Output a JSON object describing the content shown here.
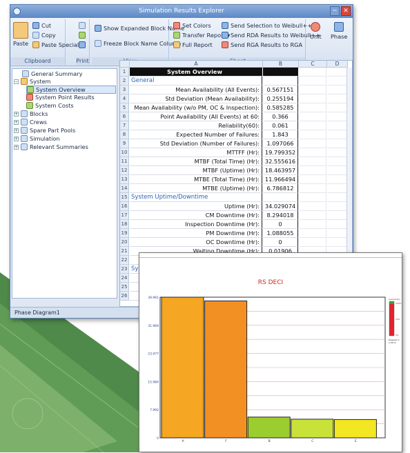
{
  "window": {
    "title": "Simulation Results Explorer"
  },
  "ribbon": {
    "paste": "Paste",
    "cut": "Cut",
    "copy": "Copy",
    "paste_special": "Paste Special",
    "show_expanded": "Show Expanded Block Name",
    "freeze_block": "Freeze Block Name Column",
    "set_colors": "Set Colors",
    "transfer_report": "Transfer Report ▾",
    "full_report": "Full Report",
    "send_selection": "Send Selection to Weibull++",
    "send_rda": "Send RDA Results to Weibull++",
    "send_rga": "Send RGA Results to RGA",
    "unit": "Unit",
    "phase": "Phase",
    "groups": {
      "clipboard": "Clipboard",
      "print": "Print",
      "view": "View",
      "sheet": "Sheet"
    }
  },
  "tree": {
    "general_summary": "General Summary",
    "system": "System",
    "system_overview": "System Overview",
    "system_point_results": "System Point Results",
    "system_costs": "System Costs",
    "blocks": "Blocks",
    "crews": "Crews",
    "spare_part_pools": "Spare Part Pools",
    "simulation": "Simulation",
    "relevant_summaries": "Relevant Summaries"
  },
  "sheet": {
    "columns": [
      "A",
      "B",
      "C",
      "D"
    ],
    "rows": [
      {
        "n": "1",
        "label": "System Overview",
        "value": "",
        "type": "hdr"
      },
      {
        "n": "2",
        "label": "General",
        "value": "",
        "type": "sec"
      },
      {
        "n": "3",
        "label": "Mean Availability (All Events):",
        "value": "0.567151"
      },
      {
        "n": "4",
        "label": "Std Deviation (Mean Availability):",
        "value": "0.255194"
      },
      {
        "n": "5",
        "label": "Mean Availability (w/o PM, OC & Inspection):",
        "value": "0.585285"
      },
      {
        "n": "6",
        "label": "Point Availability (All Events) at 60:",
        "value": "0.366"
      },
      {
        "n": "7",
        "label": "Reliability(60):",
        "value": "0.061"
      },
      {
        "n": "8",
        "label": "Expected Number of Failures:",
        "value": "1.843"
      },
      {
        "n": "9",
        "label": "Std Deviation (Number of Failures):",
        "value": "1.097066"
      },
      {
        "n": "10",
        "label": "MTTFF (Hr):",
        "value": "19.799352"
      },
      {
        "n": "11",
        "label": "MTBF (Total Time) (Hr):",
        "value": "32.555616"
      },
      {
        "n": "12",
        "label": "MTBF (Uptime) (Hr):",
        "value": "18.463957"
      },
      {
        "n": "13",
        "label": "MTBE (Total Time) (Hr):",
        "value": "11.966494"
      },
      {
        "n": "14",
        "label": "MTBE (Uptime) (Hr):",
        "value": "6.786812"
      },
      {
        "n": "15",
        "label": "System Uptime/Downtime",
        "value": "",
        "type": "sec"
      },
      {
        "n": "16",
        "label": "Uptime (Hr):",
        "value": "34.029074"
      },
      {
        "n": "17",
        "label": "CM Downtime (Hr):",
        "value": "8.294018"
      },
      {
        "n": "18",
        "label": "Inspection Downtime (Hr):",
        "value": "0"
      },
      {
        "n": "19",
        "label": "PM Downtime (Hr):",
        "value": "1.088055"
      },
      {
        "n": "20",
        "label": "OC Downtime (Hr):",
        "value": "0"
      },
      {
        "n": "21",
        "label": "Waiting Downtime (Hr):",
        "value": "0.01906"
      },
      {
        "n": "22",
        "label": "",
        "value": ""
      },
      {
        "n": "23",
        "label": "Sys",
        "value": "",
        "type": "sec"
      },
      {
        "n": "24",
        "label": "",
        "value": ""
      },
      {
        "n": "25",
        "label": "",
        "value": ""
      },
      {
        "n": "26",
        "label": "",
        "value": ""
      }
    ]
  },
  "statusbar": {
    "text": "Phase Diagram1"
  },
  "chart_data": {
    "type": "bar",
    "title": "RS DECI",
    "categories": [
      "A",
      "F",
      "B",
      "C",
      "E"
    ],
    "values": [
      39.96,
      38.9,
      5.9,
      5.3,
      5.2
    ],
    "colors": [
      "#f5a623",
      "#f39024",
      "#9ccd2e",
      "#c8e23a",
      "#f3e622"
    ],
    "yticks": [
      "0",
      "7.992",
      "15.984",
      "23.977",
      "31.969",
      "39.961"
    ],
    "ylim": [
      0,
      39.961
    ],
    "legend": {
      "items": [
        "Availability",
        "100%",
        "50%",
        "0%",
        "Diagram 1",
        "1.00 hr"
      ]
    }
  }
}
